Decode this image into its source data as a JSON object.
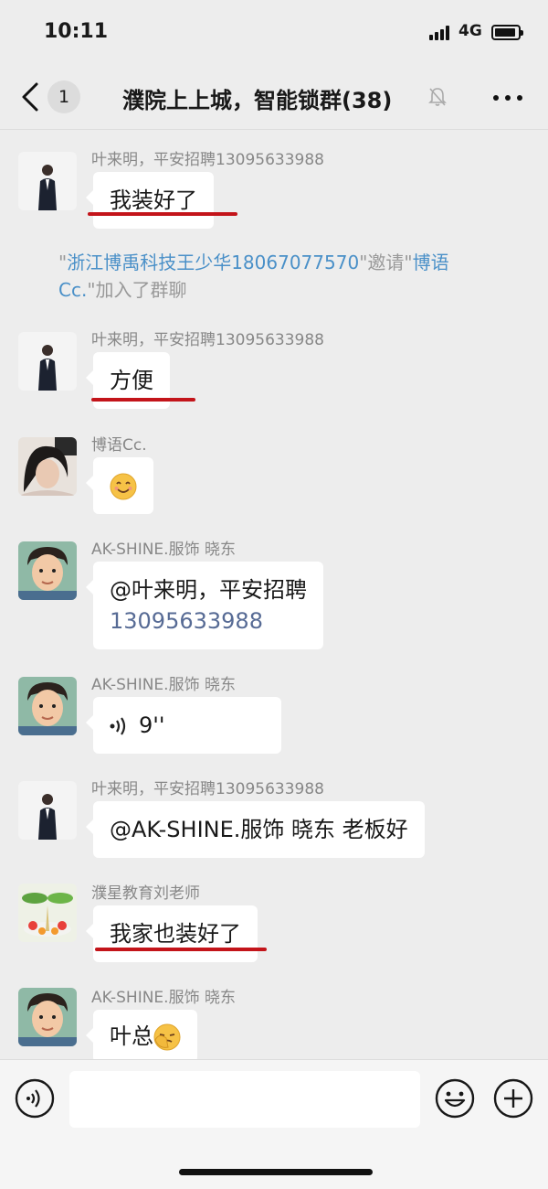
{
  "status_bar": {
    "time": "10:11",
    "network": "4G"
  },
  "nav": {
    "unread_count": "1",
    "title": "濮院上上城，智能锁群(38)"
  },
  "system_message": {
    "inviter": "浙江博禹科技王少华18067077570",
    "verb": "邀请",
    "invitee": "博语Cc.",
    "suffix": "加入了群聊"
  },
  "messages": [
    {
      "sender": "叶来明，平安招聘13095633988",
      "text": "我装好了",
      "underlined": true
    },
    {
      "sender": "叶来明，平安招聘13095633988",
      "text": "方便",
      "underlined": true
    },
    {
      "sender": "博语Cc.",
      "emoji": "smile-emoji"
    },
    {
      "sender": "AK-SHINE.服饰 晓东",
      "mention": "@叶来明，平安招聘",
      "phone": "13095633988"
    },
    {
      "sender": "AK-SHINE.服饰 晓东",
      "voice_duration": "9''"
    },
    {
      "sender": "叶来明，平安招聘13095633988",
      "text": "@AK-SHINE.服饰 晓东 老板好"
    },
    {
      "sender": "濮星教育刘老师",
      "text": "我家也装好了",
      "underlined": true
    },
    {
      "sender": "AK-SHINE.服饰 晓东",
      "text": "叶总",
      "emoji": "facepalm-emoji"
    }
  ],
  "colors": {
    "background": "#ededed",
    "bubble": "#ffffff",
    "link": "#576b95",
    "underline": "#c3141a"
  },
  "icons": [
    "back-arrow-icon",
    "mute-bell-icon",
    "more-icon",
    "voice-input-icon",
    "emoji-icon",
    "plus-icon",
    "voice-wave-icon"
  ]
}
